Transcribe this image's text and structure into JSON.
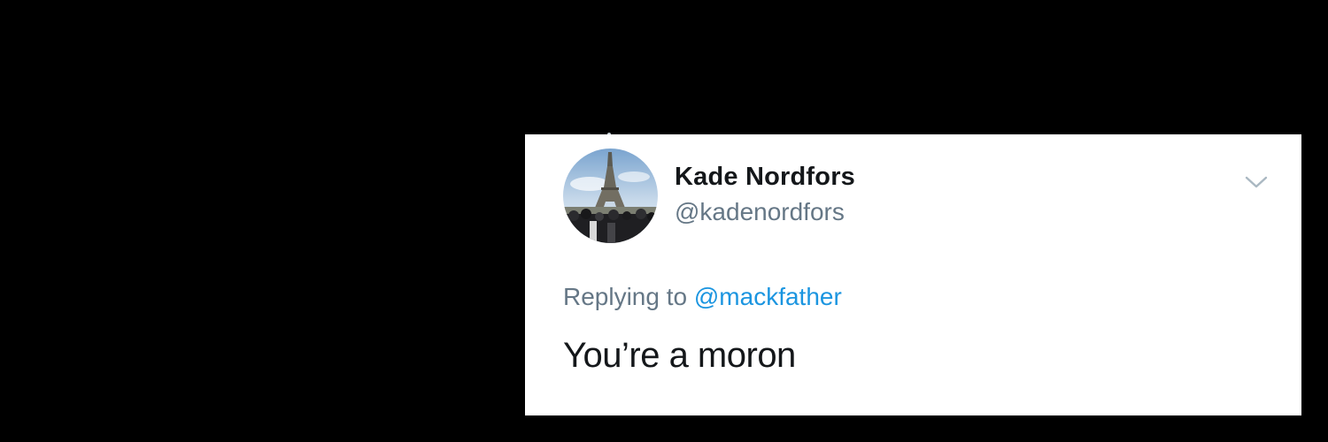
{
  "tweet": {
    "author": {
      "display_name": "Kade Nordfors",
      "handle": "@kadenordfors",
      "avatar_icon": "eiffel-tower-photo-avatar"
    },
    "replying_to": {
      "prefix": "Replying to",
      "mention": "@mackfather"
    },
    "text": "You’re a moron",
    "menu_icon": "chevron-down-icon"
  },
  "colors": {
    "background": "#000000",
    "card": "#ffffff",
    "name": "#14171a",
    "secondary": "#657786",
    "link": "#1b95e0"
  }
}
